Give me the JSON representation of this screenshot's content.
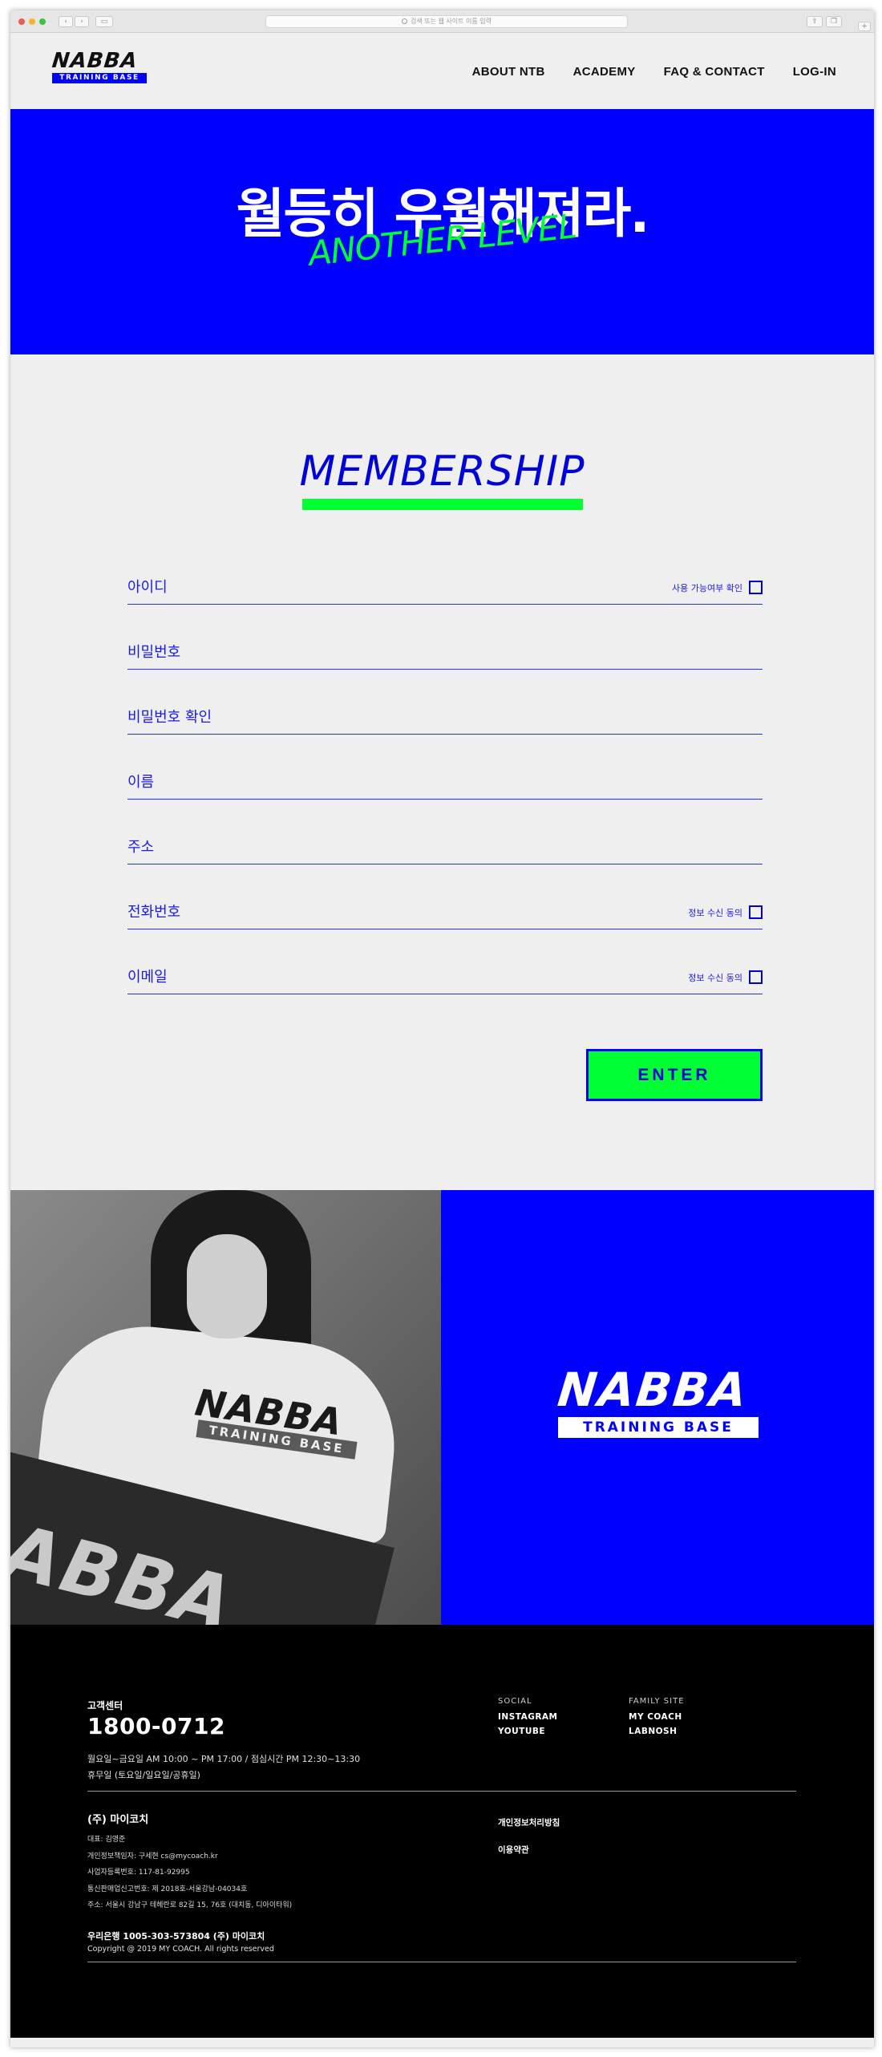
{
  "browser": {
    "address_placeholder": "검색 또는 웹 사이트 이름 입력",
    "back_glyph": "‹",
    "forward_glyph": "›"
  },
  "header": {
    "logo_word": "NABBA",
    "logo_sub": "TRAINING BASE",
    "menu": [
      "ABOUT NTB",
      "ACADEMY",
      "FAQ & CONTACT",
      "LOG-IN"
    ]
  },
  "hero": {
    "title": "월등히 우월해져라.",
    "subtitle": "ANOTHER LEVEL"
  },
  "membership": {
    "title": "MEMBERSHIP",
    "fields": [
      {
        "label": "아이디",
        "check_label": "사용 가능여부 확인"
      },
      {
        "label": "비밀번호"
      },
      {
        "label": "비밀번호 확인"
      },
      {
        "label": "이름"
      },
      {
        "label": "주소"
      },
      {
        "label": "전화번호",
        "check_label": "정보 수신 동의"
      },
      {
        "label": "이메일",
        "check_label": "정보 수신 동의"
      }
    ],
    "enter_label": "ENTER"
  },
  "promo": {
    "photo_shirt_word": "NABBA",
    "photo_shirt_sub": "TRAINING BASE",
    "photo_banner_word": "ABBA",
    "brand_word": "NABBA",
    "brand_sub": "TRAINING BASE"
  },
  "footer": {
    "cs_label": "고객센터",
    "phone": "1800-0712",
    "hours_line1": "월요일~금요일 AM 10:00 ~ PM 17:00 / 점심시간 PM 12:30~13:30",
    "hours_line2": "휴무일 (토요일/일요일/공휴일)",
    "social_head": "SOCIAL",
    "social_links": [
      "INSTAGRAM",
      "YOUTUBE"
    ],
    "family_head": "FAMILY SITE",
    "family_links": [
      "MY COACH",
      "LABNOSH"
    ],
    "company": "(주) 마이코치",
    "info": [
      "대표: 김영준",
      "개인정보책임자: 구세현 cs@mycoach.kr",
      "사업자등록번호: 117-81-92995",
      "통신판매업신고번호: 제 2018호-서울강남-04034호",
      "주소: 서울시 강남구 테헤란로 82길 15, 76호 (대치동, 디아이타워)"
    ],
    "policy_links": [
      "개인정보처리방침",
      "이용약관"
    ],
    "bank": "우리은행 1005-303-573804 (주) 마이코치",
    "copyright": "Copyright @ 2019 MY COACH. All rights reserved"
  }
}
